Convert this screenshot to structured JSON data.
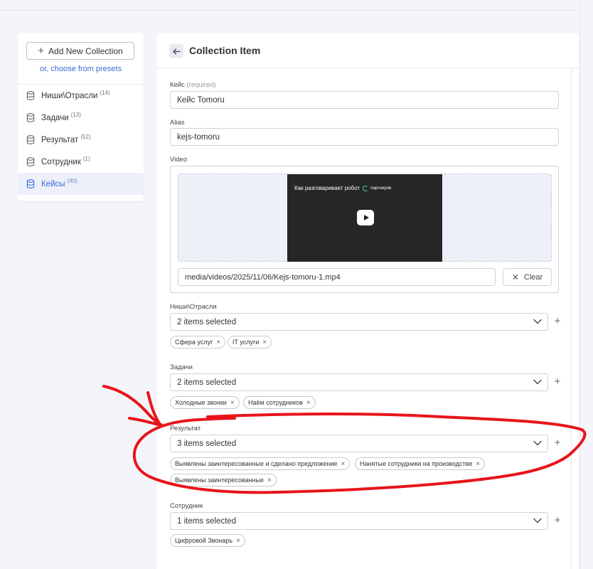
{
  "sidebar": {
    "add_collection_label": "Add New Collection",
    "presets_link": "or, choose from presets",
    "collections": [
      {
        "name": "Ниши\\Отрасли",
        "count": "(14)",
        "active": false
      },
      {
        "name": "Задачи",
        "count": "(13)",
        "active": false
      },
      {
        "name": "Результат",
        "count": "(52)",
        "active": false
      },
      {
        "name": "Сотрудник",
        "count": "(1)",
        "active": false
      },
      {
        "name": "Кейсы",
        "count": "(40)",
        "active": true
      }
    ]
  },
  "editor": {
    "title": "Collection Item",
    "fields": {
      "keys_label": "Кейс",
      "keys_required": "(required)",
      "keys_value": "Кейс Tomoru",
      "alias_label": "Alias",
      "alias_value": "kejs-tomoru",
      "video_label": "Video",
      "video_caption": "Как разговаривает робот",
      "video_caption_partner": "партнеров",
      "video_path": "media/videos/2025/11/06/Kejs-tomoru-1.mp4",
      "clear_label": "Clear"
    },
    "relations": [
      {
        "label": "Ниши\\Отрасли",
        "selected": "2 items selected",
        "chips": [
          "Сфера услуг",
          "IT услуги"
        ]
      },
      {
        "label": "Задачи",
        "selected": "2 items selected",
        "chips": [
          "Холодные звонки",
          "Наём сотрудников"
        ]
      },
      {
        "label": "Результат",
        "selected": "3 items selected",
        "chips": [
          "Выявлены заинтересованные и сделано предложение",
          "Нанятые сотрудники на производстве",
          "Выявлены заинтересованные"
        ]
      },
      {
        "label": "Сотрудник",
        "selected": "1 items selected",
        "chips": [
          "Цифровой Звонарь"
        ]
      }
    ]
  },
  "colors": {
    "accent": "#3a6bd8",
    "annotation": "#e8141b",
    "background": "#f4f5fa"
  },
  "icons": {
    "collection": "database-icon",
    "back": "arrow-left-icon",
    "dropdown": "chevron-down-icon",
    "add": "plus-icon",
    "remove": "close-icon",
    "play": "play-icon"
  }
}
